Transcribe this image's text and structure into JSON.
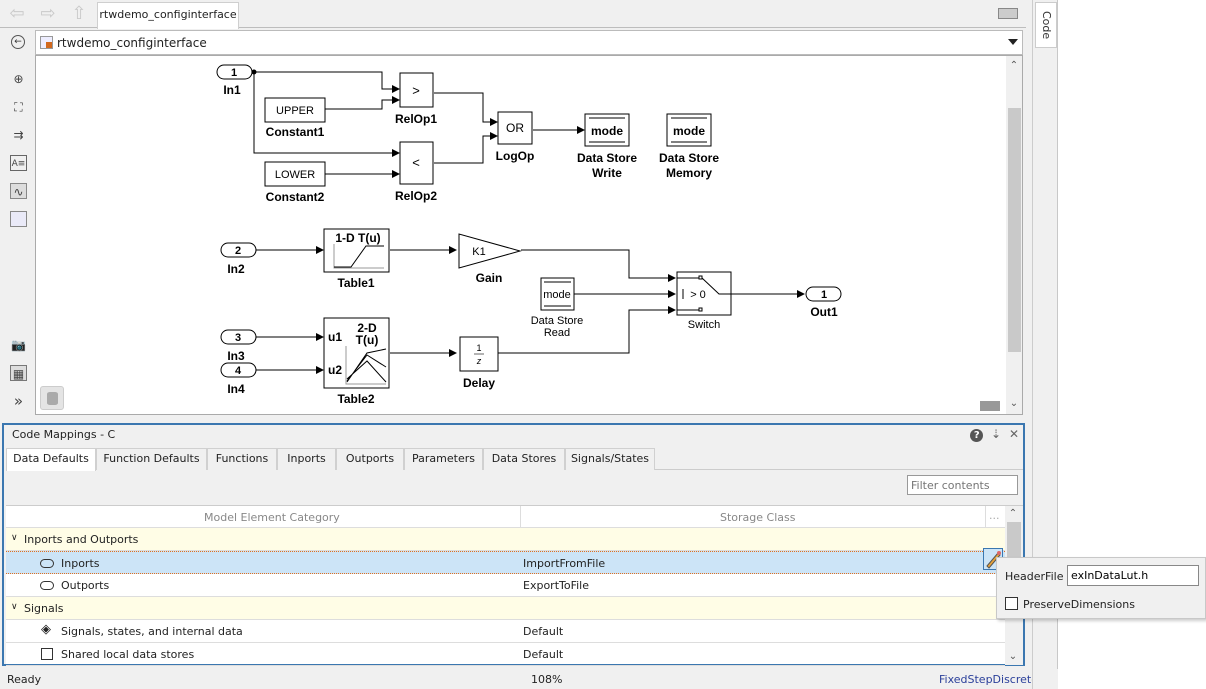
{
  "window": {
    "tab_label": "rtwdemo_configinterface",
    "address": "rtwdemo_configinterface",
    "side_tab": "Code"
  },
  "nav": {
    "back_icon": "back-arrow-icon",
    "forward_icon": "forward-arrow-icon",
    "up_icon": "up-arrow-icon"
  },
  "left_tools": [
    "zoom-in-icon",
    "fit-view-icon",
    "signal-routing-icon",
    "annotation-icon",
    "image-icon",
    "area-icon",
    "screenshot-icon",
    "model-browser-icon",
    "expand-icon"
  ],
  "diagram": {
    "blocks": {
      "in1": {
        "port": "1",
        "label": "In1"
      },
      "in2": {
        "port": "2",
        "label": "In2"
      },
      "in3": {
        "port": "3",
        "label": "In3"
      },
      "in4": {
        "port": "4",
        "label": "In4"
      },
      "out1": {
        "port": "1",
        "label": "Out1"
      },
      "constant1": {
        "value": "UPPER",
        "label": "Constant1"
      },
      "constant2": {
        "value": "LOWER",
        "label": "Constant2"
      },
      "relop1": {
        "op": ">",
        "label": "RelOp1"
      },
      "relop2": {
        "op": "<",
        "label": "RelOp2"
      },
      "logop": {
        "op": "OR",
        "label": "LogOp"
      },
      "dsw": {
        "name": "mode",
        "label1": "Data Store",
        "label2": "Write"
      },
      "dsm": {
        "name": "mode",
        "label1": "Data Store",
        "label2": "Memory"
      },
      "dsr": {
        "name": "mode",
        "label1": "Data Store",
        "label2": "Read"
      },
      "table1": {
        "title": "1-D T(u)",
        "label": "Table1"
      },
      "table2": {
        "title1": "2-D",
        "title2": "T(u)",
        "u1": "u1",
        "u2": "u2",
        "label": "Table2"
      },
      "gain": {
        "value": "K1",
        "label": "Gain"
      },
      "delay": {
        "num": "1",
        "den": "z",
        "label": "Delay"
      },
      "switch": {
        "cond": "> 0",
        "label": "Switch"
      }
    }
  },
  "panel": {
    "title": "Code Mappings - C",
    "tabs": [
      "Data Defaults",
      "Function Defaults",
      "Functions",
      "Inports",
      "Outports",
      "Parameters",
      "Data Stores",
      "Signals/States"
    ],
    "active_tab": "Data Defaults",
    "filter_placeholder": "Filter contents",
    "columns": [
      "Model Element Category",
      "Storage Class",
      "..."
    ],
    "rows": [
      {
        "type": "group",
        "category": "Inports and Outports",
        "storage": ""
      },
      {
        "type": "item",
        "icon": "inport-icon",
        "category": "Inports",
        "storage": "ImportFromFile",
        "selected": true
      },
      {
        "type": "item",
        "icon": "outport-icon",
        "category": "Outports",
        "storage": "ExportToFile"
      },
      {
        "type": "group",
        "category": "Signals",
        "storage": ""
      },
      {
        "type": "item",
        "icon": "signal-icon",
        "category": "Signals, states, and internal data",
        "storage": "Default"
      },
      {
        "type": "item",
        "icon": "datastore-icon",
        "category": "Shared local data stores",
        "storage": "Default"
      }
    ]
  },
  "popup": {
    "header_label": "HeaderFile",
    "header_value": "exInDataLut.h",
    "preserve_label": "PreserveDimensions",
    "preserve_checked": false
  },
  "status": {
    "left": "Ready",
    "zoom": "108%",
    "solver": "FixedStepDiscrete"
  }
}
